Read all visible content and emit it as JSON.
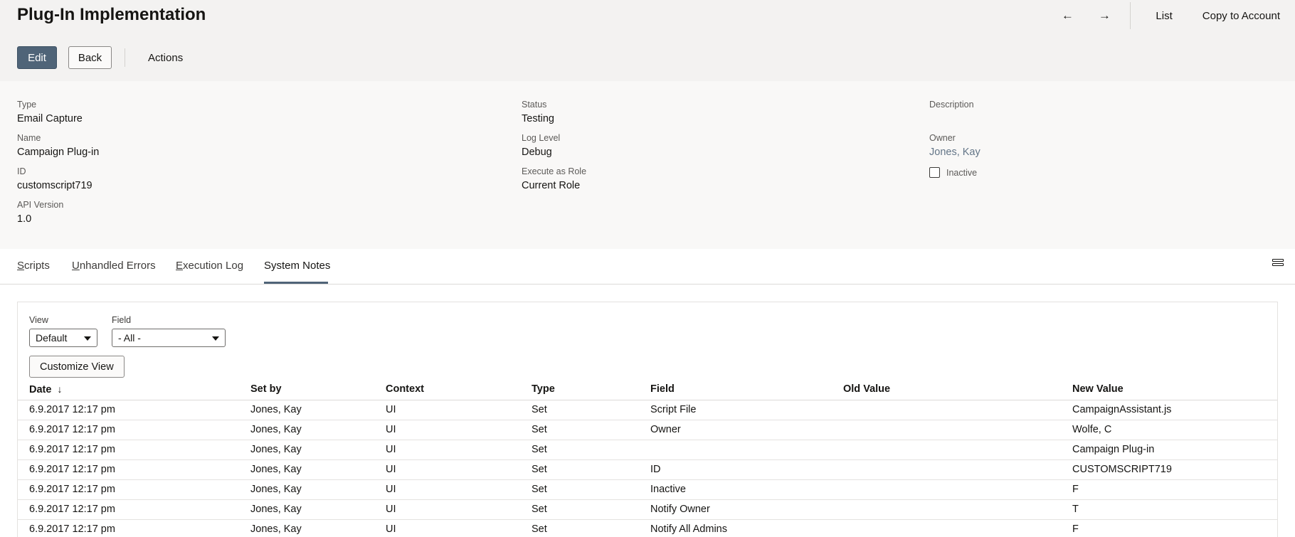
{
  "header": {
    "title": "Plug-In Implementation",
    "nav": {
      "prev_icon": "←",
      "next_icon": "→",
      "list_label": "List",
      "copy_label": "Copy to Account"
    },
    "buttons": {
      "edit": "Edit",
      "back": "Back",
      "actions": "Actions"
    }
  },
  "fields": {
    "type": {
      "label": "Type",
      "value": "Email Capture"
    },
    "name": {
      "label": "Name",
      "value": "Campaign Plug-in"
    },
    "id": {
      "label": "ID",
      "value": "customscript719"
    },
    "api_version": {
      "label": "API Version",
      "value": "1.0"
    },
    "status": {
      "label": "Status",
      "value": "Testing"
    },
    "log_level": {
      "label": "Log Level",
      "value": "Debug"
    },
    "execute_as_role": {
      "label": "Execute as Role",
      "value": "Current Role"
    },
    "description": {
      "label": "Description",
      "value": ""
    },
    "owner": {
      "label": "Owner",
      "value": "Jones, Kay"
    },
    "inactive": {
      "label": "Inactive",
      "checked": false
    }
  },
  "tabs": [
    {
      "first": "S",
      "rest": "cripts"
    },
    {
      "first": "U",
      "rest": "nhandled Errors"
    },
    {
      "first": "E",
      "rest": "xecution Log"
    },
    {
      "label": "System Notes",
      "active": true
    }
  ],
  "filters": {
    "view": {
      "label": "View",
      "value": "Default"
    },
    "field": {
      "label": "Field",
      "value": "- All -"
    },
    "customize_label": "Customize View"
  },
  "table": {
    "columns": [
      "Date",
      "Set by",
      "Context",
      "Type",
      "Field",
      "Old Value",
      "New Value"
    ],
    "sort_indicator": "↓",
    "rows": [
      [
        "6.9.2017 12:17 pm",
        "Jones, Kay",
        "UI",
        "Set",
        "Script File",
        "",
        "CampaignAssistant.js"
      ],
      [
        "6.9.2017 12:17 pm",
        "Jones, Kay",
        "UI",
        "Set",
        "Owner",
        "",
        "Wolfe, C"
      ],
      [
        "6.9.2017 12:17 pm",
        "Jones, Kay",
        "UI",
        "Set",
        "",
        "",
        "Campaign Plug-in"
      ],
      [
        "6.9.2017 12:17 pm",
        "Jones, Kay",
        "UI",
        "Set",
        "ID",
        "",
        "CUSTOMSCRIPT719"
      ],
      [
        "6.9.2017 12:17 pm",
        "Jones, Kay",
        "UI",
        "Set",
        "Inactive",
        "",
        "F"
      ],
      [
        "6.9.2017 12:17 pm",
        "Jones, Kay",
        "UI",
        "Set",
        "Notify Owner",
        "",
        "T"
      ],
      [
        "6.9.2017 12:17 pm",
        "Jones, Kay",
        "UI",
        "Set",
        "Notify All Admins",
        "",
        "F"
      ]
    ]
  }
}
